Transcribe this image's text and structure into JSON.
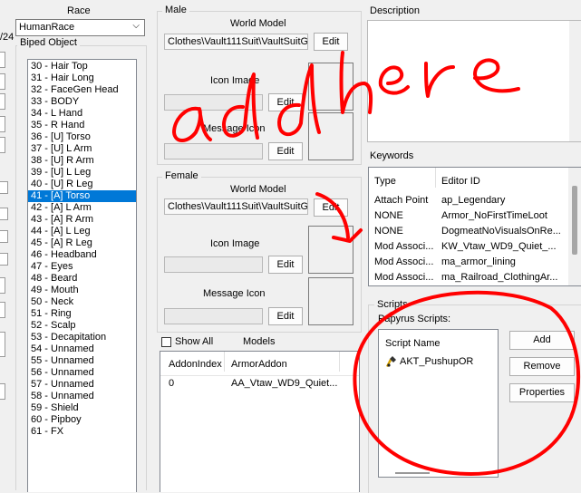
{
  "left_edge": {
    "partial_label": "/24"
  },
  "race": {
    "label": "Race",
    "value": "HumanRace"
  },
  "biped": {
    "label": "Biped Object",
    "items": [
      "30 - Hair Top",
      "31 - Hair Long",
      "32 - FaceGen Head",
      "33 - BODY",
      "34 - L Hand",
      "35 - R Hand",
      "36 - [U] Torso",
      "37 - [U] L Arm",
      "38 - [U] R Arm",
      "39 - [U] L Leg",
      "40 - [U] R Leg",
      "41 - [A] Torso",
      "42 - [A] L Arm",
      "43 - [A] R Arm",
      "44 - [A] L Leg",
      "45 - [A] R Leg",
      "46 - Headband",
      "47 - Eyes",
      "48 - Beard",
      "49 - Mouth",
      "50 - Neck",
      "51 - Ring",
      "52 - Scalp",
      "53 - Decapitation",
      "54 - Unnamed",
      "55 - Unnamed",
      "56 - Unnamed",
      "57 - Unnamed",
      "58 - Unnamed",
      "59 - Shield",
      "60 - Pipboy",
      "61 - FX"
    ],
    "selected": "41 - [A] Torso"
  },
  "male": {
    "title": "Male",
    "world_model_label": "World Model",
    "world_model_value": "Clothes\\Vault111Suit\\VaultSuitG",
    "edit": "Edit",
    "icon_image_label": "Icon Image",
    "message_icon_label": "Message Icon"
  },
  "female": {
    "title": "Female",
    "world_model_label": "World Model",
    "world_model_value": "Clothes\\Vault111Suit\\VaultSuitG",
    "edit": "Edit",
    "icon_image_label": "Icon Image",
    "message_icon_label": "Message Icon"
  },
  "models": {
    "show_all": "Show All",
    "title": "Models",
    "columns": [
      "AddonIndex",
      "ArmorAddon"
    ],
    "rows": [
      {
        "index": "0",
        "addon": "AA_Vtaw_WD9_Quiet..."
      }
    ]
  },
  "description": {
    "label": "Description"
  },
  "keywords": {
    "label": "Keywords",
    "columns": [
      "Type",
      "Editor ID"
    ],
    "rows": [
      {
        "type": "Attach Point",
        "id": "ap_Legendary"
      },
      {
        "type": "NONE",
        "id": "Armor_NoFirstTimeLoot"
      },
      {
        "type": "NONE",
        "id": "DogmeatNoVisualsOnRe..."
      },
      {
        "type": "Mod Associ...",
        "id": "KW_Vtaw_WD9_Quiet_..."
      },
      {
        "type": "Mod Associ...",
        "id": "ma_armor_lining"
      },
      {
        "type": "Mod Associ...",
        "id": "ma_Railroad_ClothingAr..."
      }
    ]
  },
  "scripts": {
    "label": "Scripts",
    "papyrus_label": "Papyrus Scripts:",
    "column": "Script Name",
    "items": [
      "AKT_PushupOR"
    ],
    "buttons": {
      "add": "Add",
      "remove": "Remove",
      "properties": "Properties"
    }
  },
  "annotation": {
    "text": "add here",
    "color": "#ff0000"
  }
}
